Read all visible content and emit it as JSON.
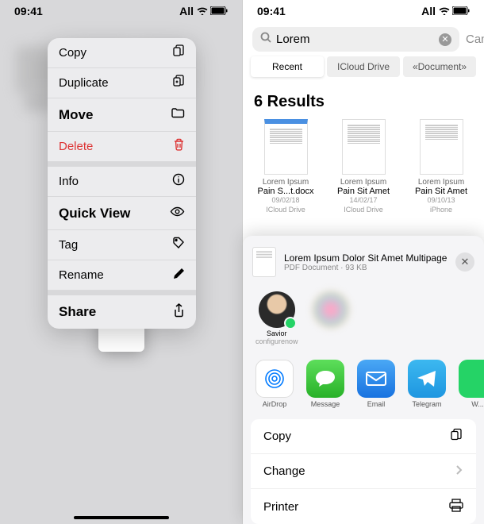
{
  "statusbar": {
    "time": "09:41",
    "carrier": "All"
  },
  "left": {
    "menu": {
      "copy": "Copy",
      "duplicate": "Duplicate",
      "move": "Move",
      "delete": "Delete",
      "info": "Info",
      "quickview": "Quick View",
      "tag": "Tag",
      "rename": "Rename",
      "share": "Share"
    }
  },
  "right": {
    "search": {
      "value": "Lorem",
      "cancel": "Cancel"
    },
    "scopes": [
      "Recent",
      "ICloud Drive",
      "«Document»"
    ],
    "results_header": "6 Results",
    "results": [
      {
        "folder": "Lorem Ipsum",
        "name": "Pain S...t.docx",
        "date": "09/02/18",
        "loc": "ICloud Drive"
      },
      {
        "folder": "Lorem Ipsum",
        "name": "Pain Sit Amet",
        "date": "14/02/17",
        "loc": "ICloud Drive"
      },
      {
        "folder": "Lorem Ipsum",
        "name": "Pain Sit Amet",
        "date": "09/10/13",
        "loc": "iPhone"
      }
    ],
    "share": {
      "title": "Lorem Ipsum Dolor Sit Amet Multipage",
      "subtitle": "PDF Document · 93 KB",
      "person": {
        "name": "Savior",
        "sub": "configurenow"
      },
      "apps": [
        "AirDrop",
        "Message",
        "Email",
        "Telegram",
        "W..."
      ],
      "actions": {
        "copy": "Copy",
        "change": "Change",
        "printer": "Printer"
      }
    }
  }
}
